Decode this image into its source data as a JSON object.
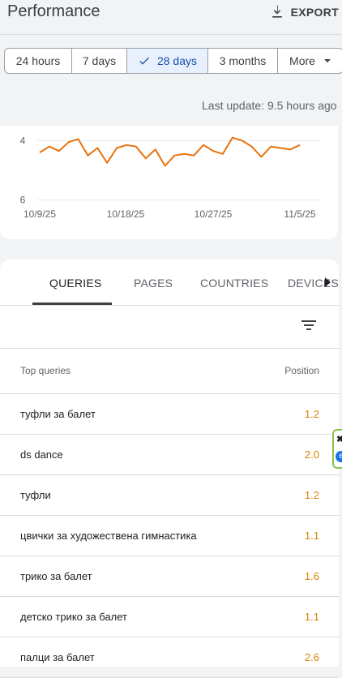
{
  "header": {
    "title": "Performance",
    "export_label": "EXPORT"
  },
  "date_range": {
    "options": [
      "24 hours",
      "7 days",
      "28 days",
      "3 months",
      "More"
    ],
    "selected": "28 days"
  },
  "last_update": "Last update: 9.5 hours ago",
  "chart_data": {
    "type": "line",
    "series": [
      {
        "values": [
          4.4,
          4.2,
          4.35,
          4.05,
          3.95,
          4.5,
          4.25,
          4.75,
          4.25,
          4.15,
          4.2,
          4.6,
          4.3,
          4.85,
          4.5,
          4.45,
          4.5,
          4.15,
          4.35,
          4.45,
          3.9,
          4.0,
          4.2,
          4.55,
          4.2,
          4.25,
          4.3,
          4.15
        ]
      }
    ],
    "x_tick_labels": [
      "10/9/25",
      "10/18/25",
      "10/27/25",
      "11/5/25"
    ],
    "y_tick_labels": [
      "4",
      "6"
    ],
    "ylim": [
      3.5,
      6.5
    ],
    "y_reversed": true,
    "color": "#e8710a",
    "grid": true
  },
  "tabs": {
    "items": [
      "QUERIES",
      "PAGES",
      "COUNTRIES",
      "DEVICES"
    ],
    "active": "QUERIES"
  },
  "table": {
    "header_query": "Top queries",
    "header_position": "Position",
    "rows": [
      {
        "query": "туфли за балет",
        "position": "1.2"
      },
      {
        "query": "ds dance",
        "position": "2.0"
      },
      {
        "query": "туфли",
        "position": "1.2"
      },
      {
        "query": "цвички за художествена гимнастика",
        "position": "1.1"
      },
      {
        "query": "трико за балет",
        "position": "1.6"
      },
      {
        "query": "детско трико за балет",
        "position": "1.1"
      },
      {
        "query": "палци за балет",
        "position": "2.6"
      }
    ]
  },
  "extension_badge": {
    "close_symbol": "✖",
    "letter": "e"
  },
  "colors": {
    "position_value": "#d68200",
    "selected_range_bg": "#e8f0fe",
    "selected_range_text": "#174ea6"
  }
}
